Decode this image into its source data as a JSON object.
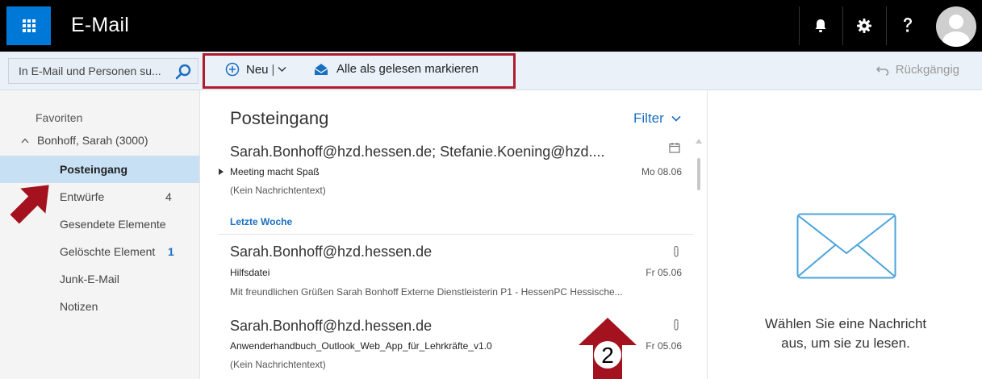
{
  "header": {
    "app_title": "E-Mail",
    "icons": [
      "waffle-icon",
      "bell-icon",
      "gear-icon",
      "help-icon",
      "avatar"
    ]
  },
  "search": {
    "placeholder": "In E-Mail und Personen su..."
  },
  "toolbar": {
    "new_label": "Neu",
    "mark_all_read_label": "Alle als gelesen markieren",
    "undo_label": "Rückgängig"
  },
  "sidebar": {
    "favorites_label": "Favoriten",
    "account_label": "Bonhoff, Sarah (3000)",
    "folders": [
      {
        "name": "Posteingang",
        "count": ""
      },
      {
        "name": "Entwürfe",
        "count": "4"
      },
      {
        "name": "Gesendete Elemente",
        "count": ""
      },
      {
        "name": "Gelöschte Element",
        "count": "1"
      },
      {
        "name": "Junk-E-Mail",
        "count": ""
      },
      {
        "name": "Notizen",
        "count": ""
      }
    ]
  },
  "list": {
    "title": "Posteingang",
    "filter_label": "Filter",
    "group_label": "Letzte Woche",
    "messages": [
      {
        "sender": "Sarah.Bonhoff@hzd.hessen.de; Stefanie.Koening@hzd....",
        "subject": "Meeting macht Spaß",
        "preview": "(Kein Nachrichtentext)",
        "date": "Mo 08.06",
        "icon": "calendar-icon"
      },
      {
        "sender": "Sarah.Bonhoff@hzd.hessen.de",
        "subject": "Hilfsdatei",
        "preview": "Mit freundlichen Grüßen Sarah Bonhoff Externe Dienstleisterin P1 - HessenPC Hessische...",
        "date": "Fr 05.06",
        "icon": "attachment-icon"
      },
      {
        "sender": "Sarah.Bonhoff@hzd.hessen.de",
        "subject": "Anwenderhandbuch_Outlook_Web_App_für_Lehrkräfte_v1.0",
        "preview": "(Kein Nachrichtentext)",
        "date": "Fr 05.06",
        "icon": "attachment-icon"
      }
    ]
  },
  "callout_number": "2",
  "reading_pane": {
    "message_line1": "Wählen Sie eine Nachricht",
    "message_line2": "aus, um sie zu lesen."
  },
  "colors": {
    "accent": "#0078d7",
    "highlight": "#b01b2e",
    "link": "#1a6fc1",
    "selection": "#c7e0f4"
  }
}
